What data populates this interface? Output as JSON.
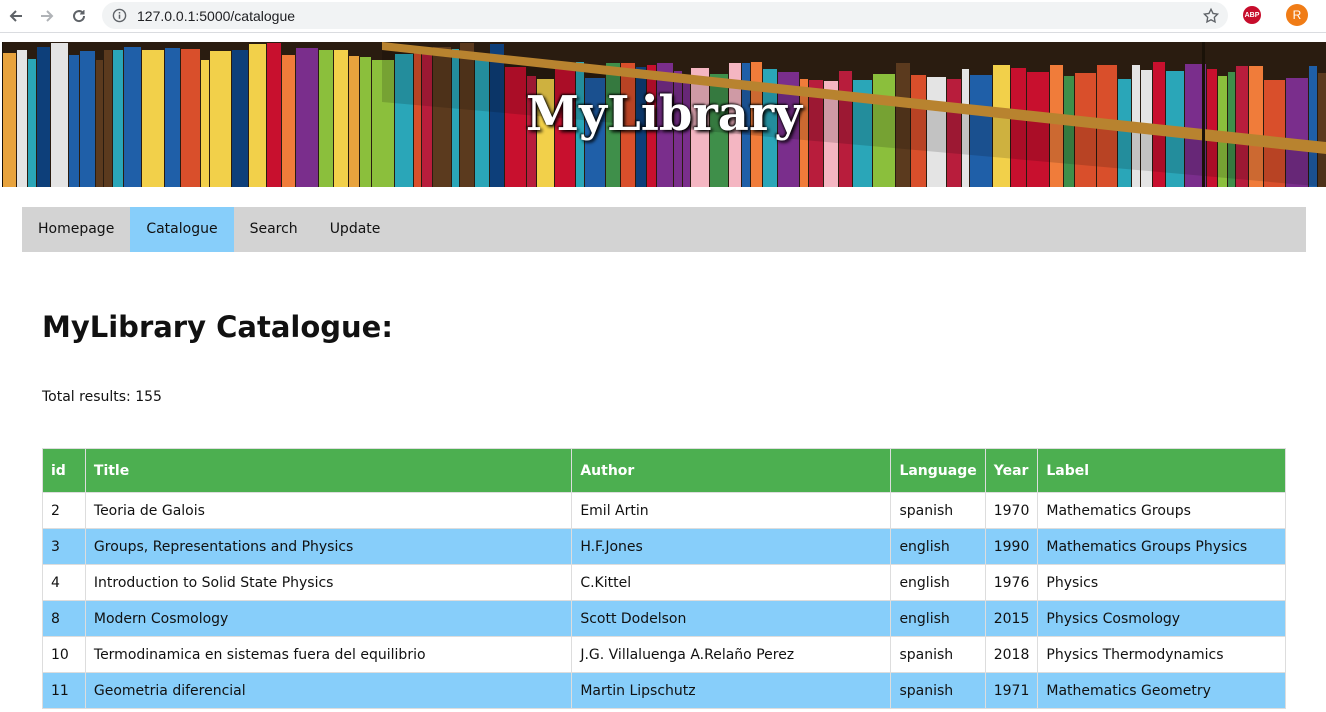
{
  "browser": {
    "url": "127.0.0.1:5000/catalogue",
    "abp_label": "ABP",
    "profile_initial": "R"
  },
  "banner": {
    "title": "MyLibrary"
  },
  "navbar": {
    "items": [
      {
        "label": "Homepage"
      },
      {
        "label": "Catalogue",
        "active": true
      },
      {
        "label": "Search"
      },
      {
        "label": "Update"
      }
    ]
  },
  "main": {
    "heading": "MyLibrary Catalogue:",
    "total_results": "Total results: 155"
  },
  "table": {
    "headers": [
      "id",
      "Title",
      "Author",
      "Language",
      "Year",
      "Label"
    ],
    "rows": [
      [
        "2",
        "Teoria de Galois",
        "Emil Artin",
        "spanish",
        "1970",
        "Mathematics Groups"
      ],
      [
        "3",
        "Groups, Representations and Physics",
        "H.F.Jones",
        "english",
        "1990",
        "Mathematics Groups Physics"
      ],
      [
        "4",
        "Introduction to Solid State Physics",
        "C.Kittel",
        "english",
        "1976",
        "Physics"
      ],
      [
        "8",
        "Modern Cosmology",
        "Scott Dodelson",
        "english",
        "2015",
        "Physics Cosmology"
      ],
      [
        "10",
        "Termodinamica en sistemas fuera del equilibrio",
        "J.G. Villaluenga A.Relaño Perez",
        "spanish",
        "2018",
        "Physics Thermodynamics"
      ],
      [
        "11",
        "Geometria diferencial",
        "Martin Lipschutz",
        "spanish",
        "1971",
        "Mathematics Geometry"
      ]
    ]
  },
  "colors": {
    "header_green": "#4caf50",
    "accent_blue": "#87cefa",
    "navbar_gray": "#d3d3d3"
  }
}
